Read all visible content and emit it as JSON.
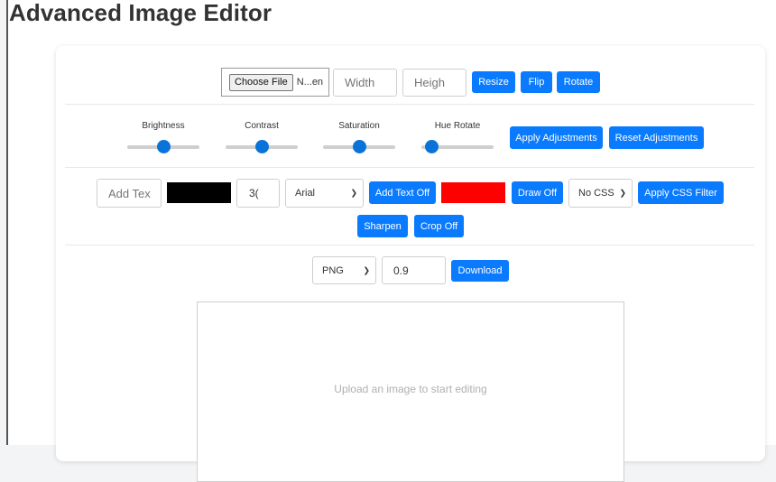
{
  "page": {
    "title": "Advanced Image Editor"
  },
  "file": {
    "button_label": "Choose File",
    "file_name": "N...en"
  },
  "resize": {
    "width_placeholder": "Width",
    "height_placeholder": "Heigh",
    "resize_label": "Resize",
    "flip_label": "Flip",
    "rotate_label": "Rotate"
  },
  "adjust": {
    "sliders": [
      {
        "label": "Brightness",
        "level": 0.5
      },
      {
        "label": "Contrast",
        "level": 0.5
      },
      {
        "label": "Saturation",
        "level": 0.5
      },
      {
        "label": "Hue Rotate",
        "level": 0
      }
    ],
    "apply_label": "Apply Adjustments",
    "reset_label": "Reset Adjustments"
  },
  "tools": {
    "text_placeholder": "Add Tex",
    "text_color": "#000000",
    "font_size_value": "3(",
    "font_family_value": "Arial",
    "add_text_label": "Add Text Off",
    "draw_color": "#ff0000",
    "draw_label": "Draw Off",
    "css_filter_value": "No CSS",
    "apply_css_label": "Apply CSS Filter",
    "sharpen_label": "Sharpen",
    "crop_label": "Crop Off"
  },
  "export": {
    "format_value": "PNG",
    "quality_value": "0.9",
    "download_label": "Download"
  },
  "canvas": {
    "placeholder": "Upload an image to start editing"
  },
  "colors": {
    "accent": "#0a7bff",
    "slider_thumb": "#0a73d9"
  }
}
